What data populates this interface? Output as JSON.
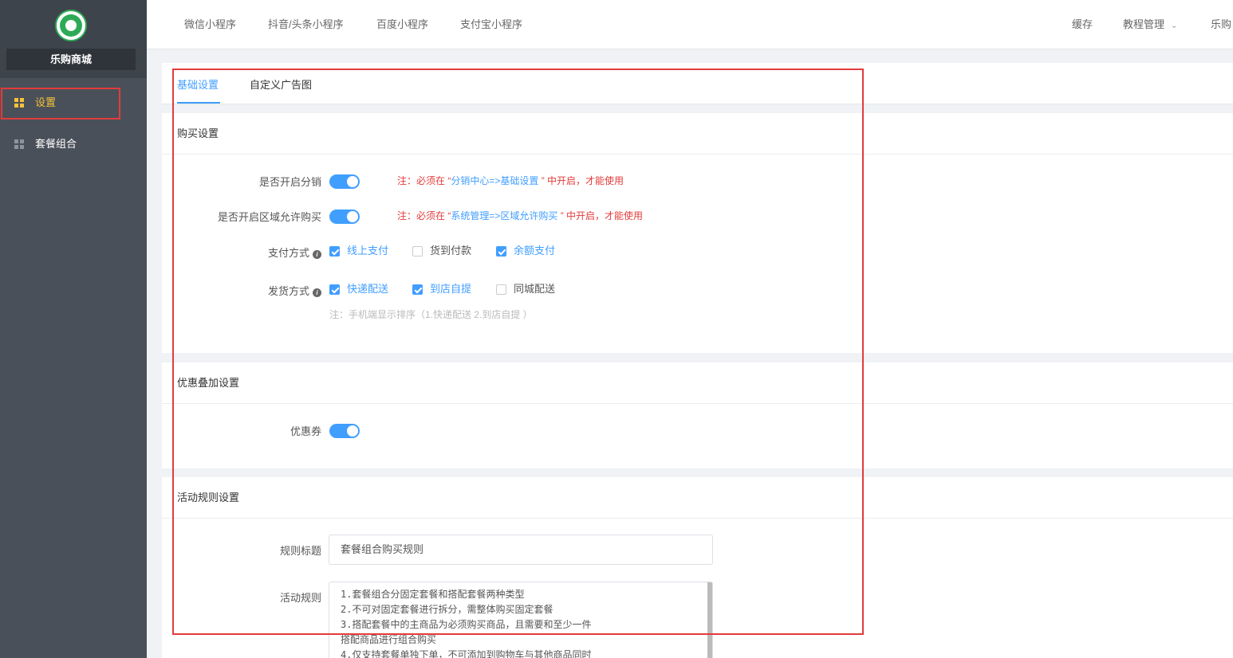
{
  "sidebar": {
    "brand": "乐购商城",
    "items": [
      {
        "label": "设置",
        "active": true
      },
      {
        "label": "套餐组合",
        "active": false
      }
    ]
  },
  "topbar": {
    "tabs": [
      "微信小程序",
      "抖音/头条小程序",
      "百度小程序",
      "支付宝小程序"
    ],
    "right": {
      "cache": "缓存",
      "tutorial": "教程管理",
      "user": "乐购"
    }
  },
  "content_tabs": [
    {
      "label": "基础设置",
      "active": true
    },
    {
      "label": "自定义广告图",
      "active": false
    }
  ],
  "purchase": {
    "title": "购买设置",
    "distribution": {
      "label": "是否开启分销",
      "enabled": true,
      "note_prefix": "注：必须在 “",
      "note_link": "分销中心=>基础设置",
      "note_suffix": " ” 中开启，才能使用"
    },
    "region": {
      "label": "是否开启区域允许购买",
      "enabled": true,
      "note_prefix": "注：必须在 “",
      "note_link": "系统管理=>区域允许购买",
      "note_suffix": " ” 中开启，才能使用"
    },
    "payment": {
      "label": "支付方式",
      "options": [
        {
          "label": "线上支付",
          "checked": true
        },
        {
          "label": "货到付款",
          "checked": false
        },
        {
          "label": "余额支付",
          "checked": true
        }
      ]
    },
    "delivery": {
      "label": "发货方式",
      "options": [
        {
          "label": "快递配送",
          "checked": true
        },
        {
          "label": "到店自提",
          "checked": true
        },
        {
          "label": "同城配送",
          "checked": false
        }
      ],
      "hint": "注：手机端显示排序（1.快递配送 2.到店自提 ）"
    }
  },
  "discount": {
    "title": "优惠叠加设置",
    "coupon": {
      "label": "优惠券",
      "enabled": true
    }
  },
  "rules": {
    "title": "活动规则设置",
    "rule_title_label": "规则标题",
    "rule_title_value": "套餐组合购买规则",
    "rule_label": "活动规则",
    "rule_lines": [
      "1.套餐组合分固定套餐和搭配套餐两种类型",
      "2.不可对固定套餐进行拆分，需整体购买固定套餐",
      "3.搭配套餐中的主商品为必须购买商品，且需要和至少一件",
      "搭配商品进行组合购买",
      "4.仅支持套餐单独下单，不可添加到购物车与其他商品同时"
    ]
  }
}
